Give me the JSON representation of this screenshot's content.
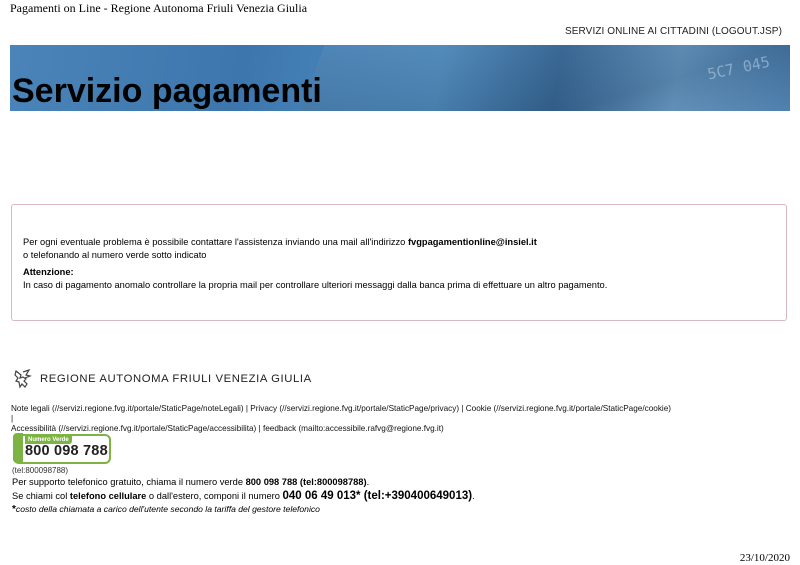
{
  "document_title": "Pagamenti on Line - Regione Autonoma Friuli Venezia Giulia",
  "top_link": "SERVIZI ONLINE AI CITTADINI (LOGOUT.JSP)",
  "banner": {
    "title": "Servizio pagamenti",
    "card_text": "5C7 045"
  },
  "info": {
    "line1_prefix": "Per ogni eventuale problema è possibile contattare l'assistenza inviando una mail all'indirizzo ",
    "email": "fvgpagamentionline@insiel.it",
    "line2": "o telefonando al numero verde sotto indicato",
    "attention_label": "Attenzione:",
    "attention_text": "In caso di pagamento anomalo controllare la propria mail per controllare ulteriori messaggi dalla banca prima di effettuare un altro pagamento."
  },
  "footer": {
    "region_name": "REGIONE AUTONOMA FRIULI VENEZIA GIULIA",
    "legal_line1": "Note legali (//servizi.regione.fvg.it/portale/StaticPage/noteLegali) | Privacy (//servizi.regione.fvg.it/portale/StaticPage/privacy) | Cookie (//servizi.regione.fvg.it/portale/StaticPage/cookie) |",
    "legal_line2": "Accessibilità (//servizi.regione.fvg.it/portale/StaticPage/accessibilita) | feedback (mailto:accessibile.rafvg@regione.fvg.it)",
    "numero_verde_label": "Numero Verde",
    "numero_verde": "800 098 788",
    "tel_link": "(tel:800098788)",
    "support1_prefix": "Per supporto telefonico gratuito, chiama il numero verde ",
    "support1_bold": "800 098 788 (tel:800098788)",
    "support1_suffix": ".",
    "support2_prefix": "Se chiami col ",
    "support2_bold1": "telefono cellulare",
    "support2_mid": " o dall'estero, componi il numero ",
    "support2_big": "040 06 49 013* (tel:+390400649013)",
    "support2_suffix": ".",
    "note_star": "*",
    "note_text": "costo della chiamata a carico dell'utente secondo la tariffa del gestore telefonico"
  },
  "date": "23/10/2020",
  "colors": {
    "banner": "#3d76ac",
    "box_border": "#d9b9c0",
    "numero_verde_green": "#7cb342"
  }
}
